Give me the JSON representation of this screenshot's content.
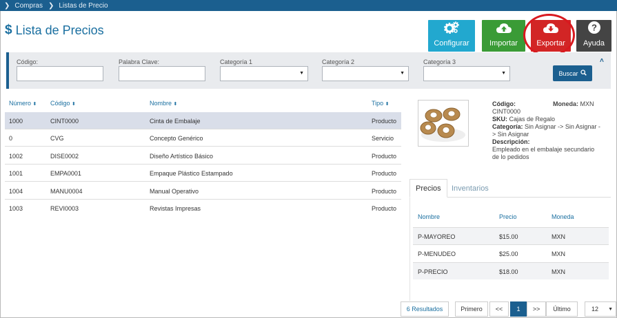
{
  "breadcrumb": {
    "items": [
      "Compras",
      "Listas de Precio"
    ]
  },
  "page": {
    "title_symbol": "$",
    "title": "Lista de Precios"
  },
  "toolbar": {
    "configure_label": "Configurar",
    "import_label": "Importar",
    "export_label": "Exportar",
    "help_label": "Ayuda"
  },
  "filters": {
    "codigo_label": "Código:",
    "codigo_value": "",
    "palabra_label": "Palabra Clave:",
    "palabra_value": "",
    "cat1_label": "Categoría 1",
    "cat1_value": "",
    "cat2_label": "Categoría 2",
    "cat2_value": "",
    "cat3_label": "Categoría 3",
    "cat3_value": "",
    "search_label": "Buscar"
  },
  "table": {
    "headers": {
      "numero": "Número",
      "codigo": "Código",
      "nombre": "Nombre",
      "tipo": "Tipo"
    },
    "rows": [
      {
        "numero": "1000",
        "codigo": "CINT0000",
        "nombre": "Cinta de Embalaje",
        "tipo": "Producto"
      },
      {
        "numero": "0",
        "codigo": "CVG",
        "nombre": "Concepto Genérico",
        "tipo": "Servicio"
      },
      {
        "numero": "1002",
        "codigo": "DISE0002",
        "nombre": "Diseño Artístico Básico",
        "tipo": "Producto"
      },
      {
        "numero": "1001",
        "codigo": "EMPA0001",
        "nombre": "Empaque Plástico Estampado",
        "tipo": "Producto"
      },
      {
        "numero": "1004",
        "codigo": "MANU0004",
        "nombre": "Manual Operativo",
        "tipo": "Producto"
      },
      {
        "numero": "1003",
        "codigo": "REVI0003",
        "nombre": "Revistas Impresas",
        "tipo": "Producto"
      }
    ]
  },
  "detail": {
    "codigo_label": "Código:",
    "codigo_value": "CINT0000",
    "moneda_label": "Moneda:",
    "moneda_value": "MXN",
    "sku_label": "SKU:",
    "sku_value": "Cajas de Regalo",
    "categoria_label": "Categoría:",
    "categoria_value": "Sin Asignar -> Sin Asignar -> Sin Asignar",
    "descripcion_label": "Descripción:",
    "descripcion_value": "Empleado en el embalaje secundario de lo pedidos"
  },
  "tabs": {
    "precios": "Precios",
    "inventarios": "Inventarios"
  },
  "prices": {
    "headers": {
      "nombre": "Nombre",
      "precio": "Precio",
      "moneda": "Moneda"
    },
    "rows": [
      {
        "nombre": "P-MAYOREO",
        "precio": "$15.00",
        "moneda": "MXN"
      },
      {
        "nombre": "P-MENUDEO",
        "precio": "$25.00",
        "moneda": "MXN"
      },
      {
        "nombre": "P-PRECIO",
        "precio": "$18.00",
        "moneda": "MXN"
      }
    ]
  },
  "pager": {
    "results": "6 Resultados",
    "first": "Primero",
    "prev": "<<",
    "current": "1",
    "next": ">>",
    "last": "Último",
    "page_size": "12"
  },
  "colors": {
    "brand": "#1b5f8f",
    "configure": "#22a8cf",
    "import": "#3a9b36",
    "export": "#d22525",
    "help": "#444444"
  }
}
